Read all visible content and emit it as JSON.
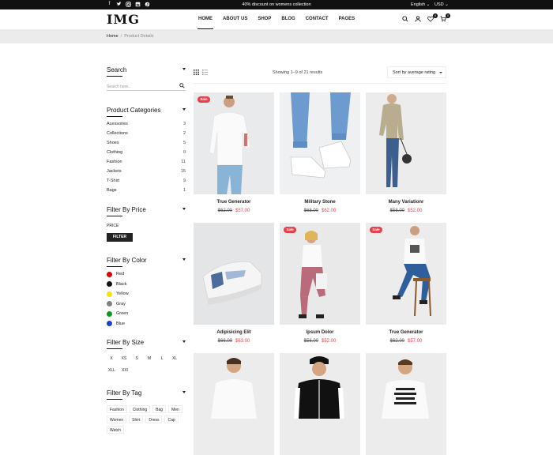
{
  "topbar": {
    "social": [
      "facebook-icon",
      "twitter-icon",
      "instagram-icon",
      "linkedin-icon",
      "pinterest-icon"
    ],
    "promo": "40% discount on womens collection",
    "language": "English",
    "currency": "USD"
  },
  "header": {
    "logo": "IMG",
    "nav": [
      "HOME",
      "ABOUT US",
      "SHOP",
      "BLOG",
      "CONTACT",
      "PAGES"
    ],
    "wishlist_count": "0",
    "cart_count": "0"
  },
  "breadcrumb": {
    "home": "Home",
    "current": "Product Details"
  },
  "sidebar": {
    "search_title": "Search",
    "search_placeholder": "Search here..",
    "categories_title": "Product Categories",
    "categories": [
      {
        "label": "Acessories",
        "count": "3"
      },
      {
        "label": "Collections",
        "count": "2"
      },
      {
        "label": "Shoes",
        "count": "5"
      },
      {
        "label": "Clothing",
        "count": "0"
      },
      {
        "label": "Fashion",
        "count": "11"
      },
      {
        "label": "Jackets",
        "count": "15"
      },
      {
        "label": "T-Shirt",
        "count": "9"
      },
      {
        "label": "Bags",
        "count": "1"
      }
    ],
    "price_title": "Filter By Price",
    "price_label": "PRICE",
    "filter_button": "FILTER",
    "color_title": "Filter By Color",
    "colors": [
      {
        "label": "Red",
        "hex": "#e00000"
      },
      {
        "label": "Black",
        "hex": "#111111"
      },
      {
        "label": "Yellow",
        "hex": "#f5e400"
      },
      {
        "label": "Gray",
        "hex": "#808080"
      },
      {
        "label": "Green",
        "hex": "#0a9a1a"
      },
      {
        "label": "Blue",
        "hex": "#1f3ed8"
      }
    ],
    "size_title": "Filter By Size",
    "sizes": [
      "X",
      "XS",
      "S",
      "M",
      "L",
      "XL",
      "XLL",
      "XXl"
    ],
    "tag_title": "Filter By Tag",
    "tags": [
      "Fashion",
      "Clothing",
      "Bag",
      "Men",
      "Women",
      "Shirt",
      "Dress",
      "Cap",
      "Watch"
    ]
  },
  "toolbar": {
    "results": "Showing 1–9 of 21 results",
    "sort": "Sort by average rating"
  },
  "products": [
    {
      "name": "True Generator",
      "old": "$62.00",
      "new": "$57.00",
      "sale": "Sale"
    },
    {
      "name": "Military Stone",
      "old": "$68.00",
      "new": "$62.00",
      "sale": ""
    },
    {
      "name": "Many Variationr",
      "old": "$58.00",
      "new": "$52.00",
      "sale": ""
    },
    {
      "name": "Adipisicing Elit",
      "old": "$66.00",
      "new": "$63.00",
      "sale": ""
    },
    {
      "name": "Ipsum Dolor",
      "old": "$56.00",
      "new": "$52.00",
      "sale": "Sale"
    },
    {
      "name": "True Generator",
      "old": "$62.00",
      "new": "$57.00",
      "sale": "Sale"
    },
    {
      "name": "",
      "old": "",
      "new": "",
      "sale": ""
    },
    {
      "name": "",
      "old": "",
      "new": "",
      "sale": ""
    },
    {
      "name": "",
      "old": "",
      "new": "",
      "sale": ""
    }
  ]
}
